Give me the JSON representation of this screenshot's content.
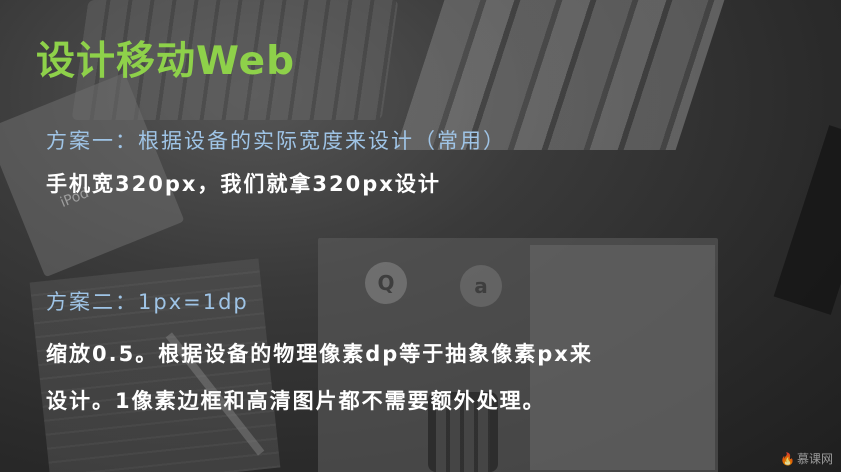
{
  "slide": {
    "title": "设计移动Web",
    "scheme1_heading": "方案一：根据设备的实际宽度来设计（常用）",
    "scheme1_text": "手机宽320px，我们就拿320px设计",
    "scheme2_heading": "方案二：1px=1dp",
    "scheme2_text_line1": "缩放0.5。根据设备的物理像素dp等于抽象像素px来",
    "scheme2_text_line2": "设计。1像素边框和高清图片都不需要额外处理。"
  },
  "background": {
    "ipod_text": "iPod",
    "logo_q": "Q",
    "logo_a": "a"
  },
  "watermark": {
    "text": "慕课网"
  },
  "colors": {
    "title": "#8ed14a",
    "heading": "#9fc4e6",
    "body": "#ffffff"
  }
}
